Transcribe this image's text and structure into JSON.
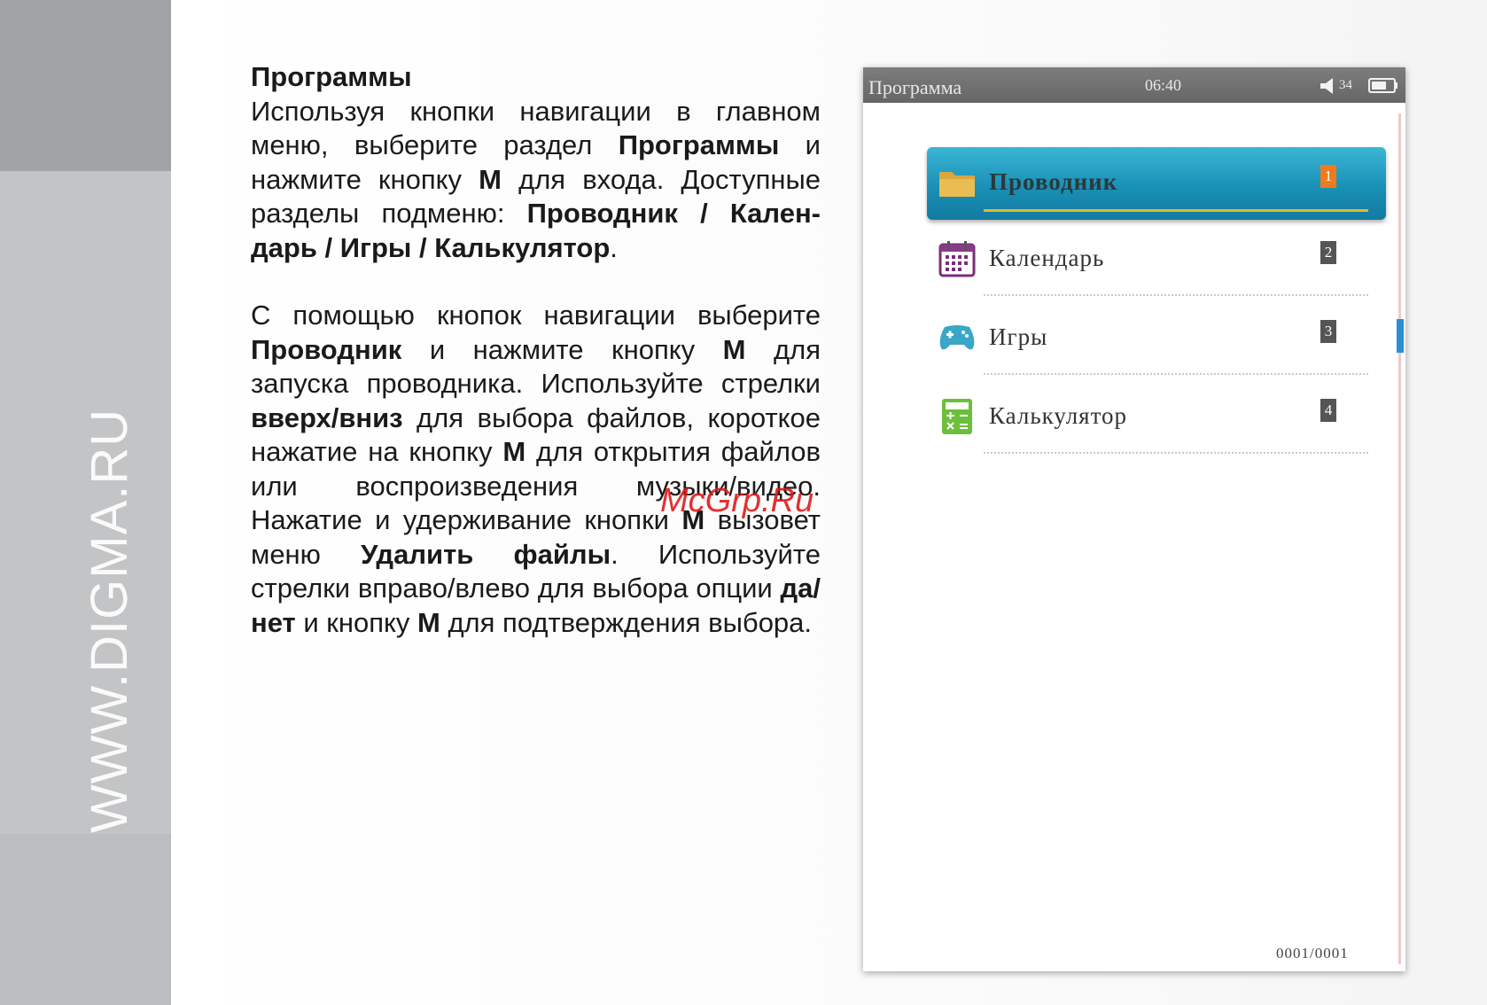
{
  "sidebar": {
    "url_text": "WWW.DIGMA.RU"
  },
  "text": {
    "heading": "Программы",
    "p1": [
      {
        "t": "Используя кнопки навигации в главном меню, выберите раздел "
      },
      {
        "t": "Программы",
        "b": true
      },
      {
        "t": " и нажмите кнопку "
      },
      {
        "t": "M",
        "b": true
      },
      {
        "t": " для входа. Доступные разделы подменю: "
      },
      {
        "t": "Проводник / Кален-дарь / Игры / Калькулятор",
        "b": true
      },
      {
        "t": "."
      }
    ],
    "p2": [
      {
        "t": "С помощью кнопок навигации выберите "
      },
      {
        "t": "Проводник",
        "b": true
      },
      {
        "t": " и нажмите кнопку "
      },
      {
        "t": "M",
        "b": true
      },
      {
        "t": " для запуска проводника. Используйте стрелки "
      },
      {
        "t": "вверх/вниз",
        "b": true
      },
      {
        "t": " для выбора файлов, короткое нажатие на кнопку "
      },
      {
        "t": "M",
        "b": true
      },
      {
        "t": " для открытия файлов или воспроизведения музыки/видео. Нажатие и удерживание кнопки "
      },
      {
        "t": "M",
        "b": true
      },
      {
        "t": " вызовет меню "
      },
      {
        "t": "Удалить файлы",
        "b": true
      },
      {
        "t": ". Используйте стрелки вправо/влево для выбора опции "
      },
      {
        "t": "да/нет",
        "b": true
      },
      {
        "t": " и кнопку "
      },
      {
        "t": "M",
        "b": true
      },
      {
        "t": " для подтверждения выбора."
      }
    ]
  },
  "watermark": "McGrp.Ru",
  "device": {
    "status": {
      "title": "Программа",
      "time": "06:40",
      "volume": "34",
      "volume_icon": "speaker-icon",
      "battery_icon": "battery-icon"
    },
    "menu": [
      {
        "label": "Проводник",
        "num": "1",
        "icon": "folder-icon",
        "selected": true
      },
      {
        "label": "Календарь",
        "num": "2",
        "icon": "calendar-icon",
        "selected": false
      },
      {
        "label": "Игры",
        "num": "3",
        "icon": "gamepad-icon",
        "selected": false
      },
      {
        "label": "Калькулятор",
        "num": "4",
        "icon": "calculator-icon",
        "selected": false
      }
    ],
    "page_counter": "0001/0001"
  },
  "colors": {
    "selected_bg": "#1a90b6",
    "selected_num": "#f07a1c",
    "selected_underline": "#e6b730",
    "scroll_thumb": "#2b8fd6",
    "watermark": "#e01b1b"
  }
}
